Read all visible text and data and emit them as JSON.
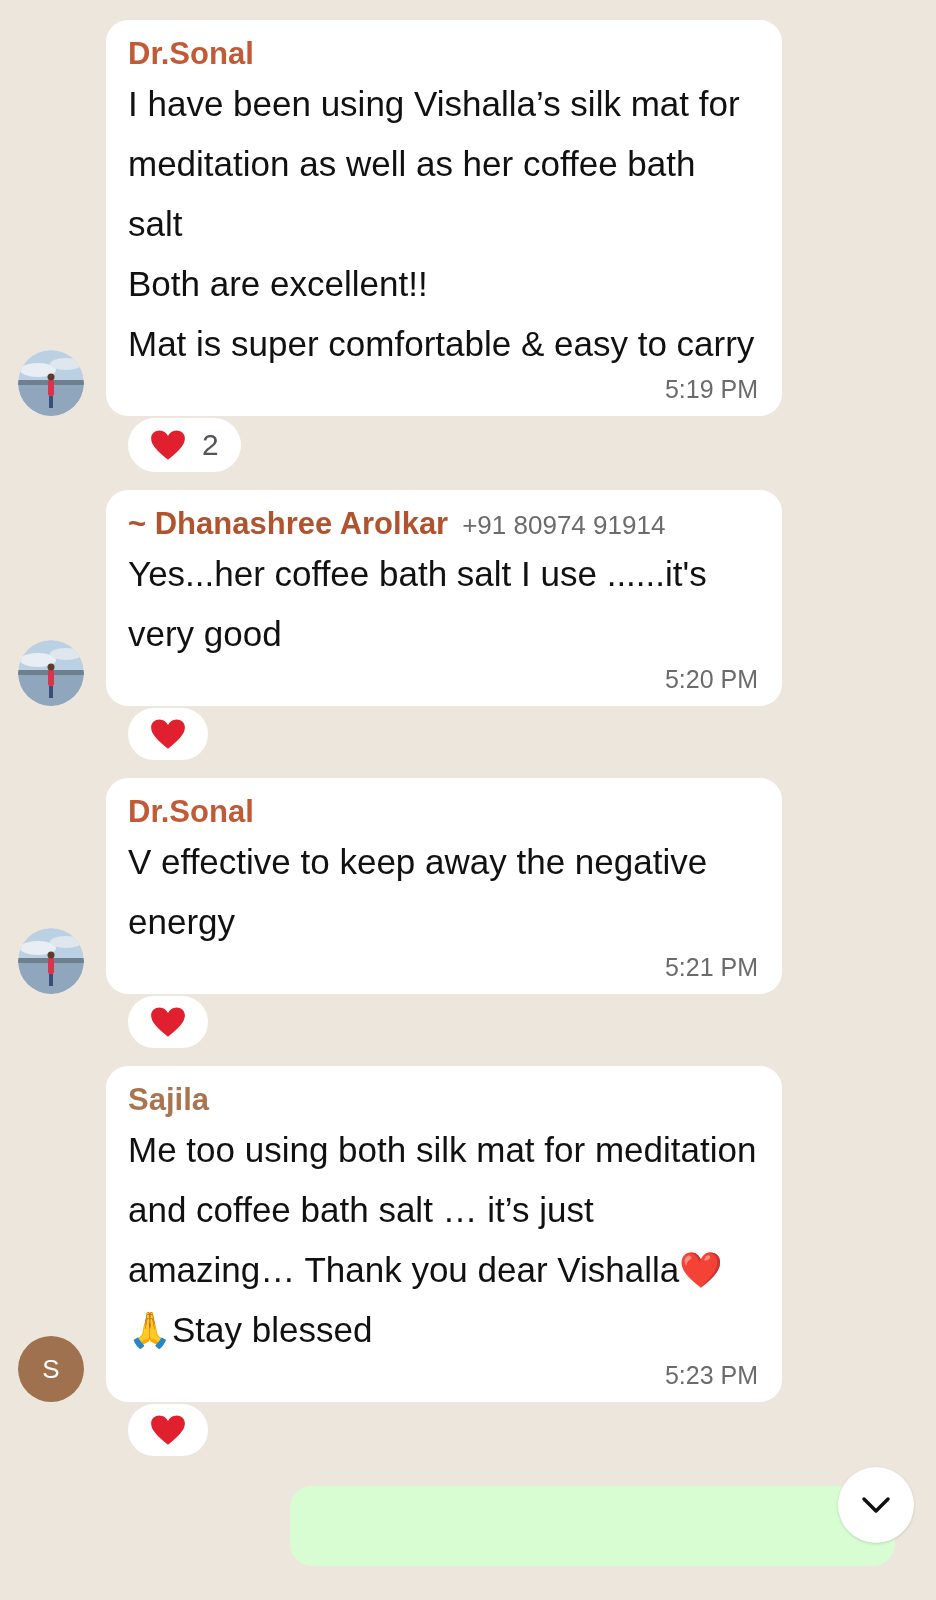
{
  "messages": [
    {
      "kind": "incoming",
      "sender": "Dr.Sonal",
      "color": "#c05a37",
      "text": "I have been using Vishalla’s silk mat for meditation as well as her coffee bath salt\nBoth are excellent!!\nMat is super comfortable & easy to carry",
      "time": "5:19 PM",
      "reaction": {
        "kind": "heart",
        "count": "2"
      }
    },
    {
      "kind": "incoming",
      "sender": "~ Dhanashree Arolkar",
      "phone": "+91 80974 91914",
      "color": "#b0532f",
      "text": "Yes...her coffee bath salt I use ......it's very good",
      "time": "5:20 PM",
      "reaction": {
        "kind": "heart"
      }
    },
    {
      "kind": "incoming",
      "sender": "Dr.Sonal",
      "color": "#c05a37",
      "text": "V effective to keep away the negative energy",
      "time": "5:21 PM",
      "reaction": {
        "kind": "heart"
      }
    },
    {
      "kind": "incoming",
      "sender": "Sajila",
      "color": "#a87550",
      "avatar": {
        "kind": "letter",
        "letter": "S"
      },
      "text": "Me too using both silk mat for meditation and coffee bath salt … it’s just amazing… Thank you dear Vishalla❤️🙏Stay blessed",
      "time": "5:23 PM",
      "reaction": {
        "kind": "heart"
      }
    },
    {
      "kind": "outgoing"
    }
  ]
}
